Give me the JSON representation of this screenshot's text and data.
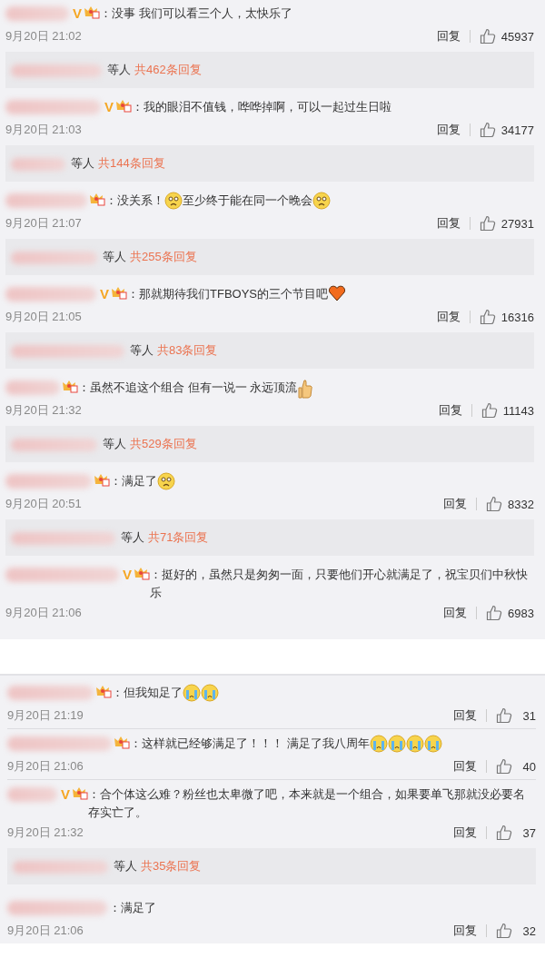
{
  "sections": [
    {
      "comments": [
        {
          "verified": "V",
          "crown": true,
          "parts": [
            {
              "kind": "text",
              "text": "：没事 我们可以看三个人，太快乐了"
            }
          ],
          "time": "9月20日 21:02",
          "reply": "回复",
          "likes": "45937",
          "replies": {
            "who": "等人",
            "count": "共462条回复"
          }
        },
        {
          "verified": "V",
          "crown": true,
          "parts": [
            {
              "kind": "text",
              "text": "：我的眼泪不值钱，哗哗掉啊，可以一起过生日啦"
            }
          ],
          "time": "9月20日 21:03",
          "reply": "回复",
          "likes": "34177",
          "replies": {
            "who": "等人",
            "count": "共144条回复"
          }
        },
        {
          "crown": true,
          "parts": [
            {
              "kind": "text",
              "text": "：没关系！"
            },
            {
              "kind": "sad"
            },
            {
              "kind": "text",
              "text": "至少终于能在同一个晚会"
            },
            {
              "kind": "sad"
            }
          ],
          "time": "9月20日 21:07",
          "reply": "回复",
          "likes": "27931",
          "replies": {
            "who": "等人",
            "count": "共255条回复"
          }
        },
        {
          "verified": "V",
          "crown": true,
          "parts": [
            {
              "kind": "text",
              "text": "：那就期待我们TFBOYS的三个节目吧"
            },
            {
              "kind": "heart"
            }
          ],
          "time": "9月20日 21:05",
          "reply": "回复",
          "likes": "16316",
          "replies": {
            "who": "等人",
            "count": "共83条回复"
          }
        },
        {
          "crown": true,
          "parts": [
            {
              "kind": "text",
              "text": "：虽然不追这个组合  但有一说一 永远顶流"
            },
            {
              "kind": "thumb"
            }
          ],
          "time": "9月20日 21:32",
          "reply": "回复",
          "likes": "11143",
          "replies": {
            "who": "等人",
            "count": "共529条回复"
          }
        },
        {
          "crown": true,
          "parts": [
            {
              "kind": "text",
              "text": "：满足了"
            },
            {
              "kind": "sad"
            }
          ],
          "time": "9月20日 20:51",
          "reply": "回复",
          "likes": "8332",
          "replies": {
            "who": "等人",
            "count": "共71条回复"
          }
        },
        {
          "verified": "V",
          "crown": true,
          "parts": [
            {
              "kind": "text",
              "text": "：挺好的，虽然只是匆匆一面，只要他们开心就满足了，祝宝贝们中秋快乐"
            }
          ],
          "time": "9月20日 21:06",
          "reply": "回复",
          "likes": "6983"
        }
      ]
    },
    {
      "comments": [
        {
          "crown": true,
          "parts": [
            {
              "kind": "text",
              "text": "：但我知足了"
            },
            {
              "kind": "cry"
            },
            {
              "kind": "cry"
            }
          ],
          "time": "9月20日 21:19",
          "reply": "回复",
          "likes": "31"
        },
        {
          "crown": true,
          "parts": [
            {
              "kind": "text",
              "text": "：这样就已经够满足了！！！ 满足了我八周年"
            },
            {
              "kind": "cry"
            },
            {
              "kind": "cry"
            },
            {
              "kind": "cry"
            },
            {
              "kind": "cry"
            }
          ],
          "time": "9月20日 21:06",
          "reply": "回复",
          "likes": "40"
        },
        {
          "verified": "V",
          "crown": true,
          "parts": [
            {
              "kind": "text",
              "text": "：合个体这么难？粉丝也太卑微了吧，本来就是一个组合，如果要单飞那就没必要名存实亡了。"
            }
          ],
          "time": "9月20日 21:32",
          "reply": "回复",
          "likes": "37",
          "replies": {
            "who": "等人",
            "count": "共35条回复"
          }
        },
        {
          "crown": false,
          "parts": [
            {
              "kind": "text",
              "text": "：满足了"
            }
          ],
          "time": "9月20日 21:06",
          "reply": "回复",
          "likes": "32"
        }
      ]
    }
  ]
}
